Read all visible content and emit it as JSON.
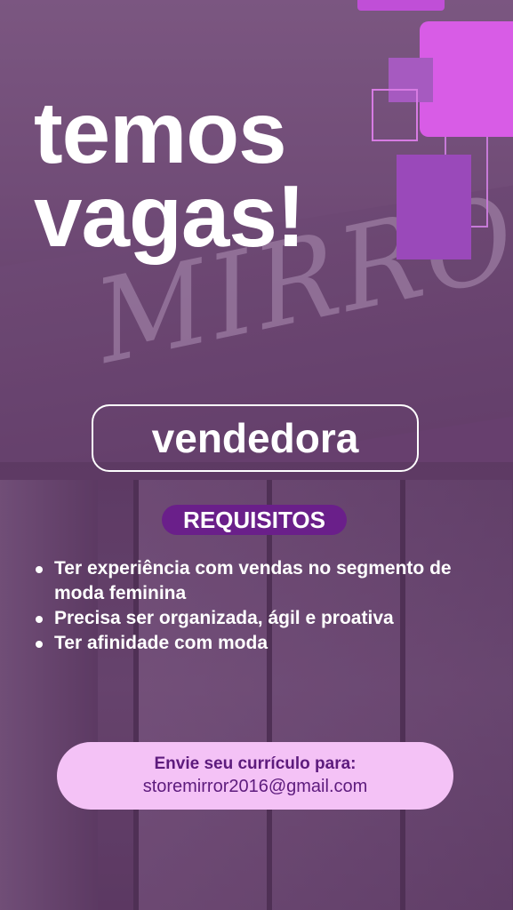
{
  "headline": {
    "line1": "temos",
    "line2": "vagas!"
  },
  "background": {
    "sign_text": "MIRROR"
  },
  "role": "vendedora",
  "requirements": {
    "title": "REQUISITOS",
    "items": [
      "Ter experiência com vendas no segmento de moda feminina",
      "Precisa ser organizada, ágil e proativa",
      "Ter afinidade com moda"
    ]
  },
  "cta": {
    "title": "Envie seu currículo para:",
    "email": "storemirror2016@gmail.com"
  },
  "colors": {
    "accent": "#d85ce6",
    "badge": "#6a1f8a",
    "cta_bg": "#f4c2f6",
    "cta_text": "#5d1b7d"
  }
}
